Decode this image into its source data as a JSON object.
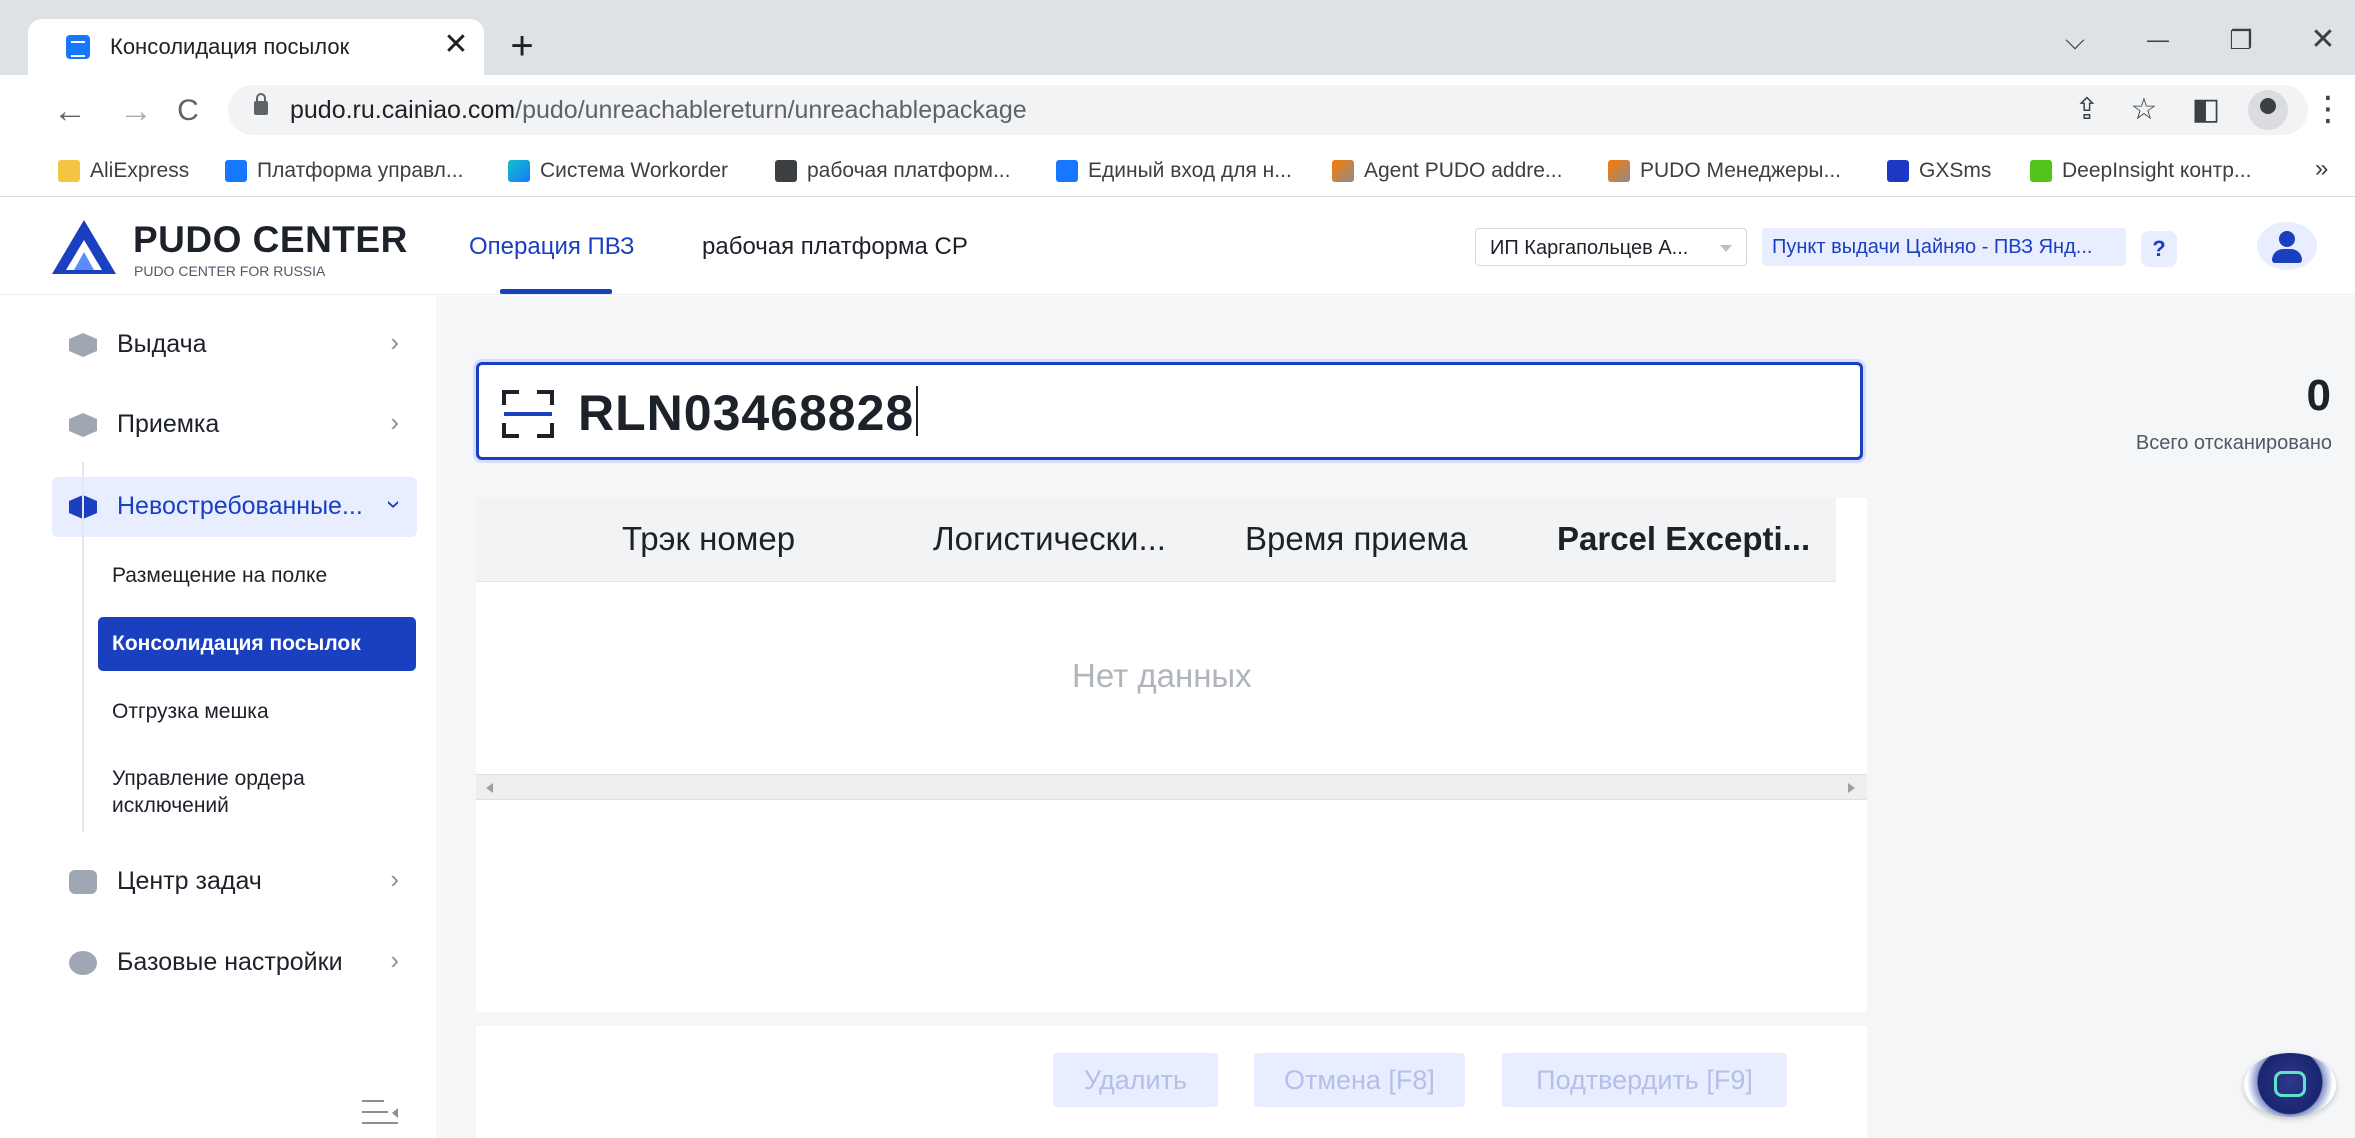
{
  "browser": {
    "tab_title": "Консолидация посылок",
    "tab_close": "✕",
    "new_tab": "+",
    "window_controls": {
      "tabs_list": "⌵",
      "minimize": "—",
      "restore": "❐",
      "close": "✕"
    },
    "nav": {
      "back": "←",
      "forward": "→",
      "reload": "C"
    },
    "url_host": "pudo.ru.cainiao.com",
    "url_path": "/pudo/unreachablereturn/unreachablepackage",
    "omni_icons": {
      "share": "⇪",
      "star": "☆",
      "sidepanel": "◧"
    },
    "menu": "⋮",
    "bookmarks": [
      {
        "label": "AliExpress",
        "icon": "folder-icon"
      },
      {
        "label": "Платформа управл...",
        "icon": "app-icon"
      },
      {
        "label": "Система Workorder",
        "icon": "workorder-icon"
      },
      {
        "label": "рабочая платформ...",
        "icon": "globe-icon"
      },
      {
        "label": "Единый вход для н...",
        "icon": "app-icon"
      },
      {
        "label": "Agent PUDO addre...",
        "icon": "pudo-icon"
      },
      {
        "label": "PUDO Менеджеры...",
        "icon": "pudo-icon"
      },
      {
        "label": "GXSms",
        "icon": "los-icon"
      },
      {
        "label": "DeepInsight контр...",
        "icon": "deepinsight-icon"
      }
    ],
    "bookmarks_more": "»"
  },
  "header": {
    "logo_title": "PUDO CENTER",
    "logo_subtitle": "PUDO CENTER FOR RUSSIA",
    "nav": [
      "Операция ПВЗ",
      "рабочая платформа CP"
    ],
    "org_select": "ИП Каргапольцев А...",
    "station": "Пункт выдачи Цайняо - ПВЗ Янд...",
    "help": "?"
  },
  "sidebar": {
    "items": [
      {
        "label": "Выдача",
        "chevron": "›"
      },
      {
        "label": "Приемка",
        "chevron": "›"
      },
      {
        "label": "Невостребованные...",
        "chevron": "›"
      },
      {
        "label": "Центр задач",
        "chevron": "›"
      },
      {
        "label": "Базовые настройки",
        "chevron": "›"
      }
    ],
    "submenu": [
      "Размещение на полке",
      "Консолидация посылок",
      "Отгрузка мешка",
      "Управление ордера исключений"
    ]
  },
  "scan": {
    "value": "RLN03468828"
  },
  "counter": {
    "value": "0",
    "label": "Всего отсканировано"
  },
  "table": {
    "columns": [
      "Трэк номер",
      "Логистически...",
      "Время приема",
      "Parcel Excepti..."
    ],
    "empty": "Нет данных"
  },
  "buttons": {
    "delete": "Удалить",
    "cancel": "Отмена [F8]",
    "confirm": "Подтвердить [F9]"
  },
  "colors": {
    "accent": "#1a3fbf",
    "accent_light": "#e8edff",
    "page_bg": "#f5f6f7"
  }
}
